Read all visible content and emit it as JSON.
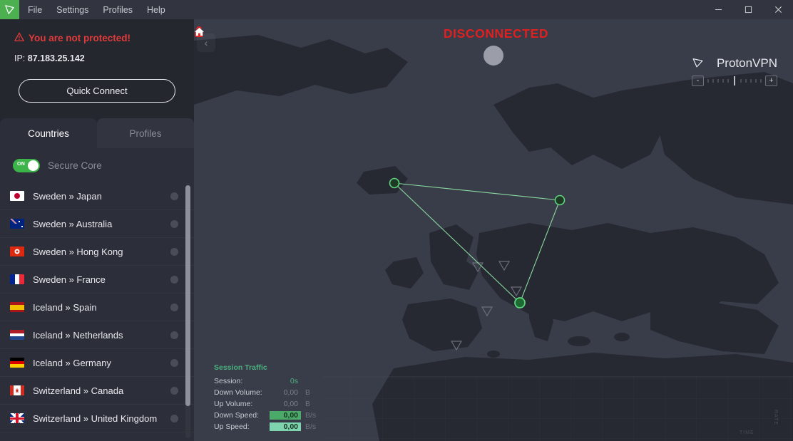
{
  "titlebar": {
    "logo_icon": "protonvpn-logo-icon",
    "menu": [
      {
        "label": "File"
      },
      {
        "label": "Settings"
      },
      {
        "label": "Profiles"
      },
      {
        "label": "Help"
      }
    ],
    "window_controls": {
      "minimize": "minimize-icon",
      "maximize": "maximize-icon",
      "close": "close-icon"
    }
  },
  "sidebar": {
    "status": {
      "warning_icon": "warning-triangle-icon",
      "warning_text": "You are not protected!",
      "ip_label": "IP:",
      "ip_value": "87.183.25.142",
      "warning_color": "#e23a3a"
    },
    "quick_connect_label": "Quick Connect",
    "tabs": [
      {
        "label": "Countries",
        "active": true
      },
      {
        "label": "Profiles",
        "active": false
      }
    ],
    "secure_core": {
      "label": "Secure Core",
      "toggle_state": "ON",
      "toggle_color": "#3cb44a"
    },
    "countries": [
      {
        "name": "Sweden » Japan",
        "flag": "jp"
      },
      {
        "name": "Sweden » Australia",
        "flag": "au"
      },
      {
        "name": "Sweden » Hong Kong",
        "flag": "hk"
      },
      {
        "name": "Sweden » France",
        "flag": "fr"
      },
      {
        "name": "Iceland » Spain",
        "flag": "es"
      },
      {
        "name": "Iceland » Netherlands",
        "flag": "nl"
      },
      {
        "name": "Iceland » Germany",
        "flag": "de"
      },
      {
        "name": "Switzerland » Canada",
        "flag": "ca"
      },
      {
        "name": "Switzerland » United Kingdom",
        "flag": "gb"
      }
    ]
  },
  "map": {
    "collapse_icon": "chevron-left-icon",
    "status": {
      "lock_icon": "unlocked-padlock-icon",
      "text": "DISCONNECTED",
      "color": "#e01f1f"
    },
    "home_button_icon": "home-icon",
    "brand": {
      "logo_icon": "protonvpn-mark-icon",
      "name": "ProtonVPN"
    },
    "zoom": {
      "minus_label": "-",
      "plus_label": "+"
    },
    "axis_labels": {
      "time": "TIME",
      "rate": "RATE"
    }
  },
  "traffic": {
    "title": "Session Traffic",
    "rows": [
      {
        "label": "Session:",
        "value": "0s",
        "unit": "",
        "style": "plain-green"
      },
      {
        "label": "Down Volume:",
        "value": "0,00",
        "unit": "B",
        "style": "muted"
      },
      {
        "label": "Up Volume:",
        "value": "0,00",
        "unit": "B",
        "style": "muted"
      },
      {
        "label": "Down Speed:",
        "value": "0,00",
        "unit": "B/s",
        "style": "bar-green"
      },
      {
        "label": "Up Speed:",
        "value": "0,00",
        "unit": "B/s",
        "style": "bar-mint"
      }
    ]
  }
}
